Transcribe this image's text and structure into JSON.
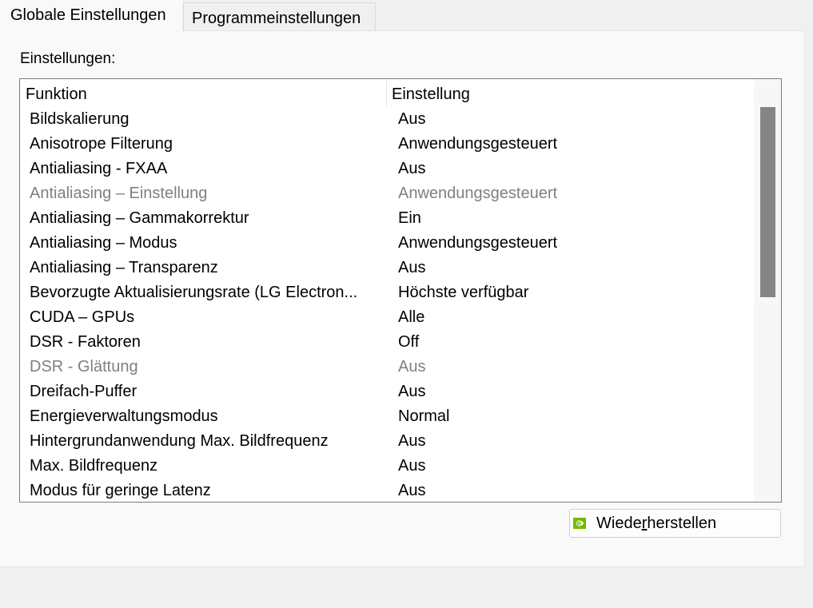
{
  "tabs": [
    {
      "label": "Globale Einstellungen",
      "active": true
    },
    {
      "label": "Programmeinstellungen",
      "active": false
    }
  ],
  "group_label": "Einstellungen:",
  "table": {
    "columns": [
      "Funktion",
      "Einstellung"
    ],
    "rows": [
      {
        "function": "Bildskalierung",
        "setting": "Aus",
        "enabled": true
      },
      {
        "function": "Anisotrope Filterung",
        "setting": "Anwendungsgesteuert",
        "enabled": true
      },
      {
        "function": "Antialiasing - FXAA",
        "setting": "Aus",
        "enabled": true
      },
      {
        "function": "Antialiasing – Einstellung",
        "setting": "Anwendungsgesteuert",
        "enabled": false
      },
      {
        "function": "Antialiasing – Gammakorrektur",
        "setting": "Ein",
        "enabled": true
      },
      {
        "function": "Antialiasing – Modus",
        "setting": "Anwendungsgesteuert",
        "enabled": true
      },
      {
        "function": "Antialiasing – Transparenz",
        "setting": "Aus",
        "enabled": true
      },
      {
        "function": "Bevorzugte Aktualisierungsrate (LG Electron...",
        "setting": "Höchste verfügbar",
        "enabled": true
      },
      {
        "function": "CUDA – GPUs",
        "setting": "Alle",
        "enabled": true
      },
      {
        "function": "DSR - Faktoren",
        "setting": "Off",
        "enabled": true
      },
      {
        "function": "DSR - Glättung",
        "setting": "Aus",
        "enabled": false
      },
      {
        "function": "Dreifach-Puffer",
        "setting": "Aus",
        "enabled": true
      },
      {
        "function": "Energieverwaltungsmodus",
        "setting": "Normal",
        "enabled": true
      },
      {
        "function": "Hintergrundanwendung Max. Bildfrequenz",
        "setting": "Aus",
        "enabled": true
      },
      {
        "function": "Max. Bildfrequenz",
        "setting": "Aus",
        "enabled": true
      },
      {
        "function": "Modus für geringe Latenz",
        "setting": "Aus",
        "enabled": true
      }
    ]
  },
  "scrollbar": {
    "visible_fraction": 0.45,
    "scroll_position": 0.0
  },
  "restore_button": {
    "label_before": "Wiede",
    "label_mnemonic": "r",
    "label_after": "herstellen",
    "icon": "nvidia-logo-icon"
  },
  "colors": {
    "disabled_text": "#7f7f7f",
    "nvidia_green": "#76b900"
  }
}
